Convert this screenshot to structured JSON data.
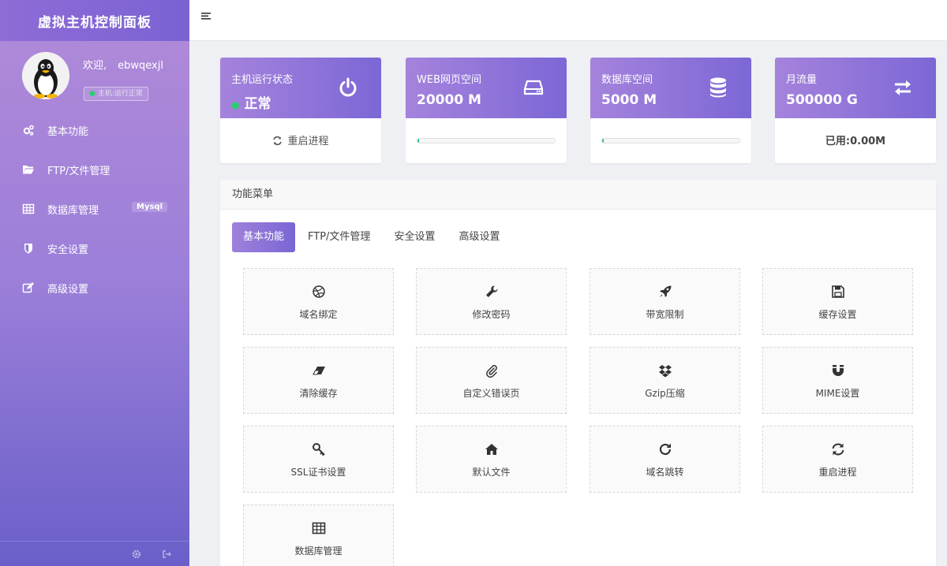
{
  "sidebar": {
    "brand": "虚拟主机控制面板",
    "welcome_prefix": "欢迎,",
    "username": "ebwqexjl",
    "status_badge": "主机:运行正常",
    "items": [
      {
        "label": "基本功能",
        "icon": "cogs-icon"
      },
      {
        "label": "FTP/文件管理",
        "icon": "folder-open-icon"
      },
      {
        "label": "数据库管理",
        "icon": "table-icon",
        "badge": "Mysql"
      },
      {
        "label": "安全设置",
        "icon": "shield-icon"
      },
      {
        "label": "高级设置",
        "icon": "edit-icon"
      }
    ]
  },
  "cards": [
    {
      "label": "主机运行状态",
      "value": "正常",
      "icon": "power-icon",
      "footer": "重启进程"
    },
    {
      "label": "WEB网页空间",
      "value": "20000 M",
      "icon": "hdd-icon",
      "progress": 0.01
    },
    {
      "label": "数据库空间",
      "value": "5000 M",
      "icon": "database-icon",
      "progress": 0.01
    },
    {
      "label": "月流量",
      "value": "500000 G",
      "icon": "exchange-icon",
      "footer": "已用:0.00M"
    }
  ],
  "panel": {
    "title": "功能菜单",
    "tabs": [
      "基本功能",
      "FTP/文件管理",
      "安全设置",
      "高级设置"
    ],
    "tiles": [
      {
        "label": "域名绑定",
        "icon": "dribbble-icon"
      },
      {
        "label": "修改密码",
        "icon": "wrench-icon"
      },
      {
        "label": "带宽限制",
        "icon": "rocket-icon"
      },
      {
        "label": "缓存设置",
        "icon": "floppy-icon"
      },
      {
        "label": "清除缓存",
        "icon": "eraser-icon"
      },
      {
        "label": "自定义错误页",
        "icon": "paperclip-icon"
      },
      {
        "label": "Gzip压缩",
        "icon": "dropbox-icon"
      },
      {
        "label": "MIME设置",
        "icon": "magnet-icon"
      },
      {
        "label": "SSL证书设置",
        "icon": "key-icon"
      },
      {
        "label": "默认文件",
        "icon": "home-icon"
      },
      {
        "label": "域名跳转",
        "icon": "redo-icon"
      },
      {
        "label": "重启进程",
        "icon": "refresh-icon"
      },
      {
        "label": "数据库管理",
        "icon": "table-icon"
      }
    ]
  },
  "colors": {
    "accent": "#7c67d6",
    "accent_light": "#a583dc",
    "progress": "#1abc9c",
    "ok": "#2ecc71"
  }
}
